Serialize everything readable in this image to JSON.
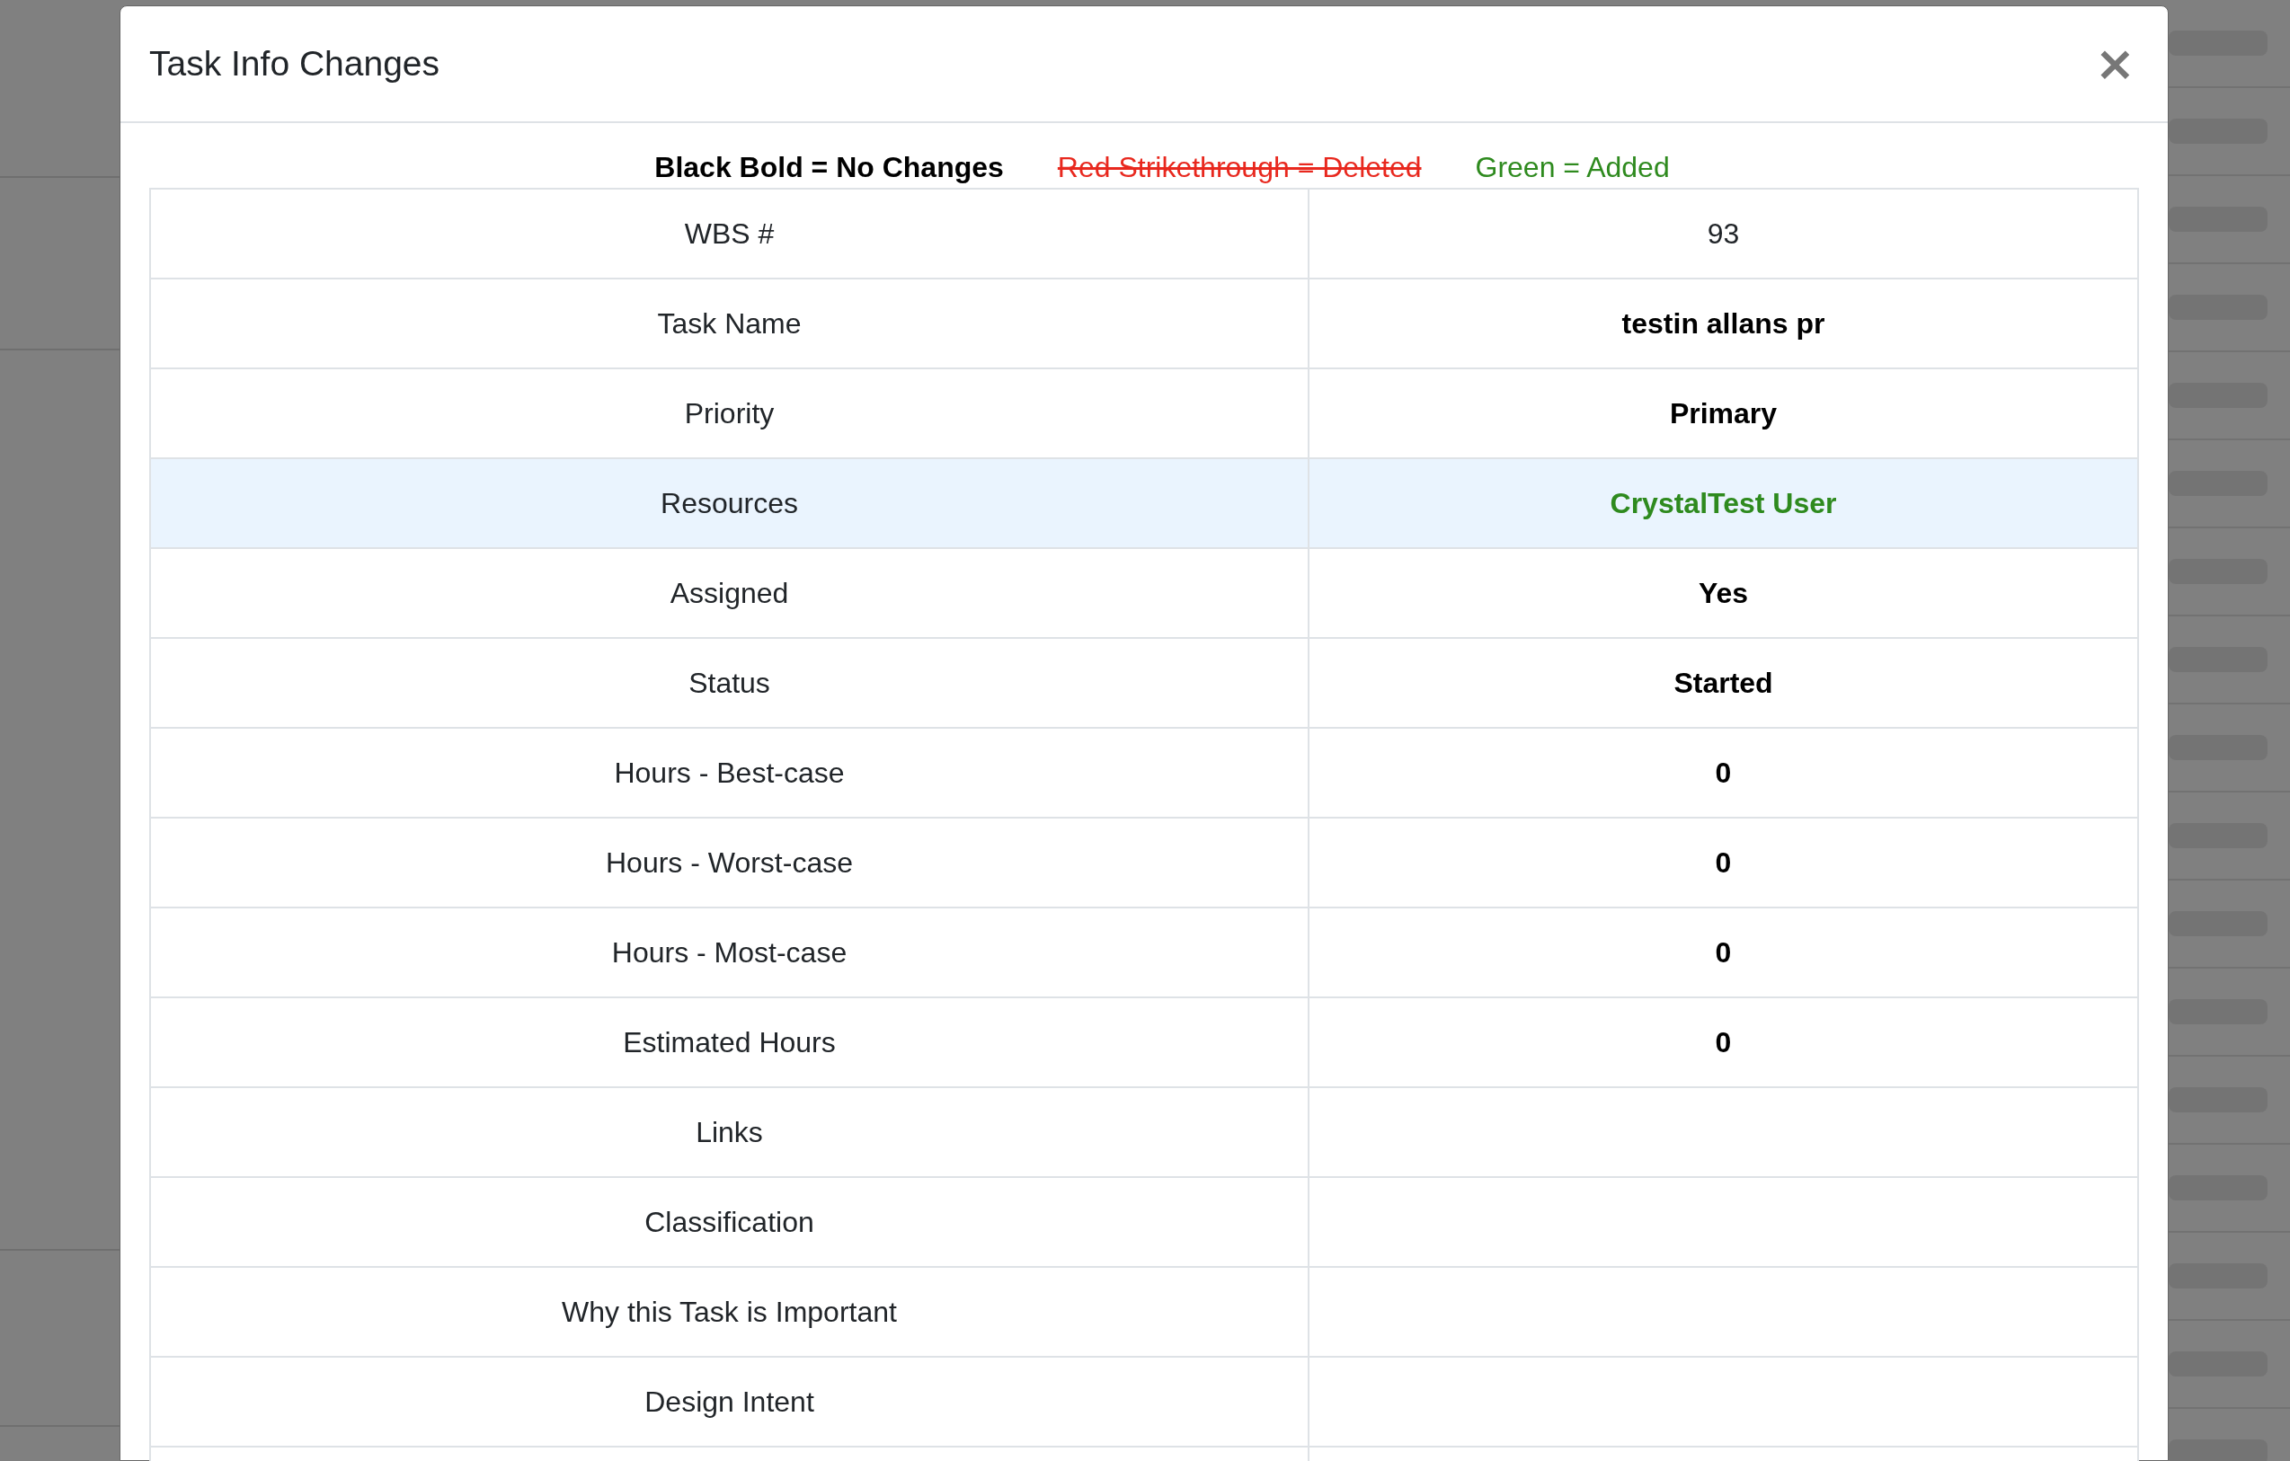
{
  "modal": {
    "title": "Task Info Changes",
    "close": "×"
  },
  "legend": [
    {
      "kind": "unchanged",
      "text": "Black Bold = No Changes"
    },
    {
      "kind": "deleted",
      "text": "Red Strikethrough = Deleted"
    },
    {
      "kind": "added",
      "text": "Green = Added"
    }
  ],
  "rows": [
    {
      "label": "WBS #",
      "value": "93",
      "kind": "plain"
    },
    {
      "label": "Task Name",
      "value": "testin allans pr",
      "kind": "unchanged"
    },
    {
      "label": "Priority",
      "value": "Primary",
      "kind": "unchanged"
    },
    {
      "label": "Resources",
      "value": "CrystalTest User",
      "kind": "added"
    },
    {
      "label": "Assigned",
      "value": "Yes",
      "kind": "unchanged"
    },
    {
      "label": "Status",
      "value": "Started",
      "kind": "unchanged"
    },
    {
      "label": "Hours - Best-case",
      "value": "0",
      "kind": "unchanged"
    },
    {
      "label": "Hours - Worst-case",
      "value": "0",
      "kind": "unchanged"
    },
    {
      "label": "Hours - Most-case",
      "value": "0",
      "kind": "unchanged"
    },
    {
      "label": "Estimated Hours",
      "value": "0",
      "kind": "unchanged"
    },
    {
      "label": "Links",
      "kind": "unchanged"
    },
    {
      "label": "Classification",
      "kind": "unchanged"
    },
    {
      "label": "Why this Task is Important",
      "kind": "unchanged"
    },
    {
      "label": "Design Intent",
      "kind": "unchanged"
    }
  ]
}
